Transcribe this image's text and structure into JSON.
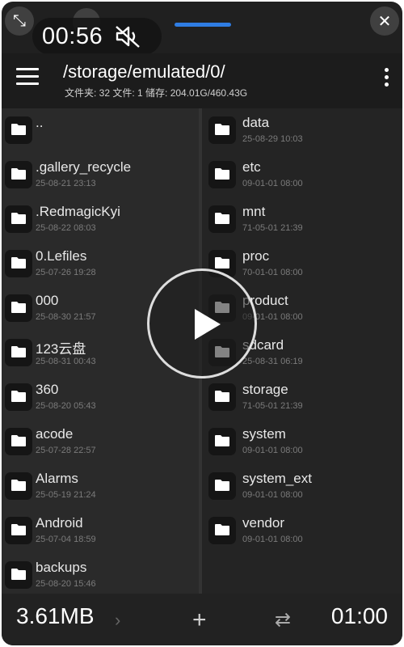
{
  "overlay": {
    "time": "00:56",
    "icons": [
      "fullscreen-exit-icon",
      "minimize-icon",
      "mute-icon",
      "close-icon"
    ]
  },
  "header": {
    "path": "/storage/emulated/0/",
    "info": "文件夹: 32  文件: 1  储存: 204.01G/460.43G"
  },
  "left_items": [
    {
      "name": "..",
      "date": ""
    },
    {
      "name": ".gallery_recycle",
      "date": "25-08-21 23:13"
    },
    {
      "name": ".RedmagicKyi",
      "date": "25-08-22 08:03"
    },
    {
      "name": "0.Lefiles",
      "date": "25-07-26 19:28"
    },
    {
      "name": "000",
      "date": "25-08-30 21:57"
    },
    {
      "name": "123云盘",
      "date": "25-08-31 00:43"
    },
    {
      "name": "360",
      "date": "25-08-20 05:43"
    },
    {
      "name": "acode",
      "date": "25-07-28 22:57"
    },
    {
      "name": "Alarms",
      "date": "25-05-19 21:24"
    },
    {
      "name": "Android",
      "date": "25-07-04 18:59"
    },
    {
      "name": "backups",
      "date": "25-08-20 15:46"
    }
  ],
  "right_items": [
    {
      "name": "data",
      "date": "25-08-29 10:03"
    },
    {
      "name": "etc",
      "date": "09-01-01 08:00"
    },
    {
      "name": "mnt",
      "date": "71-05-01 21:39"
    },
    {
      "name": "proc",
      "date": "70-01-01 08:00"
    },
    {
      "name": "product",
      "date": "09-01-01 08:00"
    },
    {
      "name": "sdcard",
      "date": "25-08-31 06:19"
    },
    {
      "name": "storage",
      "date": "71-05-01 21:39"
    },
    {
      "name": "system",
      "date": "09-01-01 08:00"
    },
    {
      "name": "system_ext",
      "date": "09-01-01 08:00"
    },
    {
      "name": "vendor",
      "date": "09-01-01 08:00"
    }
  ],
  "bottom": {
    "size": "3.61MB",
    "end_time": "01:00",
    "plus": "+",
    "swap": "⇄",
    "chev": "›"
  }
}
